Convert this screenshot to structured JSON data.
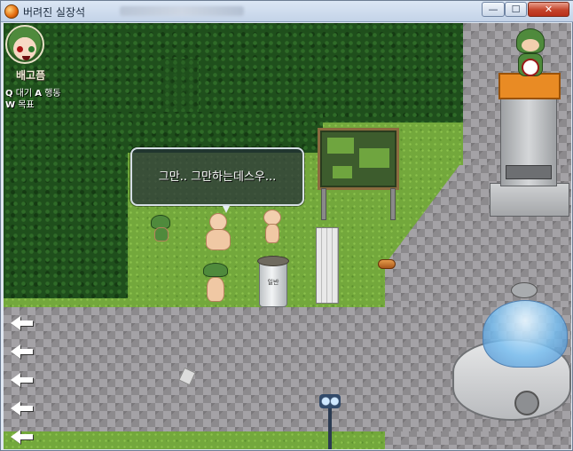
{
  "window": {
    "title": "버려진 실장석",
    "buttons": {
      "minimize": "—",
      "maximize": "☐",
      "close": "✕"
    }
  },
  "hud": {
    "status": "배고픔",
    "controls": [
      {
        "key": "Q",
        "label": "대기"
      },
      {
        "key": "A",
        "label": "행동"
      },
      {
        "key": "W",
        "label": "목표"
      }
    ]
  },
  "dialog": {
    "text": "그만.. 그만하는데스우..."
  },
  "trash_can": {
    "label": "일반"
  },
  "colors": {
    "grass": "#73a83c",
    "forest": "#1f4f1c",
    "stone": "#8c8a8d",
    "accent_orange": "#e98b24"
  }
}
